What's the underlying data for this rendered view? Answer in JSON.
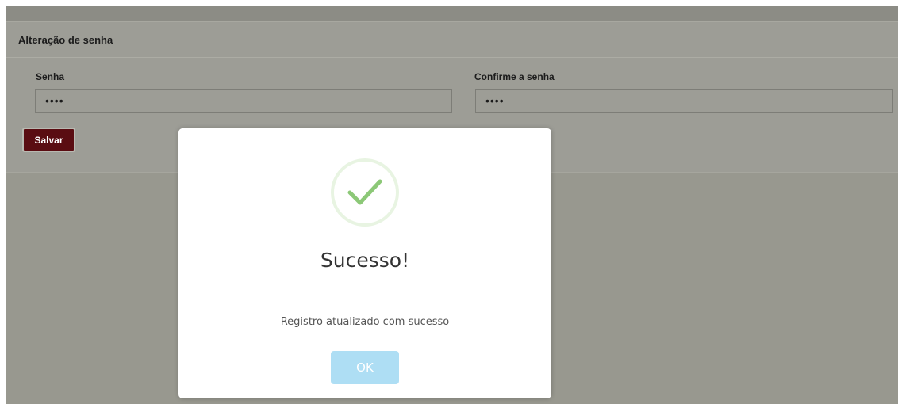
{
  "panel": {
    "title": "Alteração de senha",
    "password_label": "Senha",
    "password_value": "••••",
    "confirm_label": "Confirme a senha",
    "confirm_value": "••••",
    "save_label": "Salvar"
  },
  "modal": {
    "icon": "checkmark-icon",
    "title": "Sucesso!",
    "message": "Registro atualizado com sucesso",
    "ok_label": "OK"
  },
  "colors": {
    "overlay": "#98988f",
    "save_button": "#5a0d12",
    "ok_button": "#aedef4",
    "success_green": "#8cc877"
  }
}
